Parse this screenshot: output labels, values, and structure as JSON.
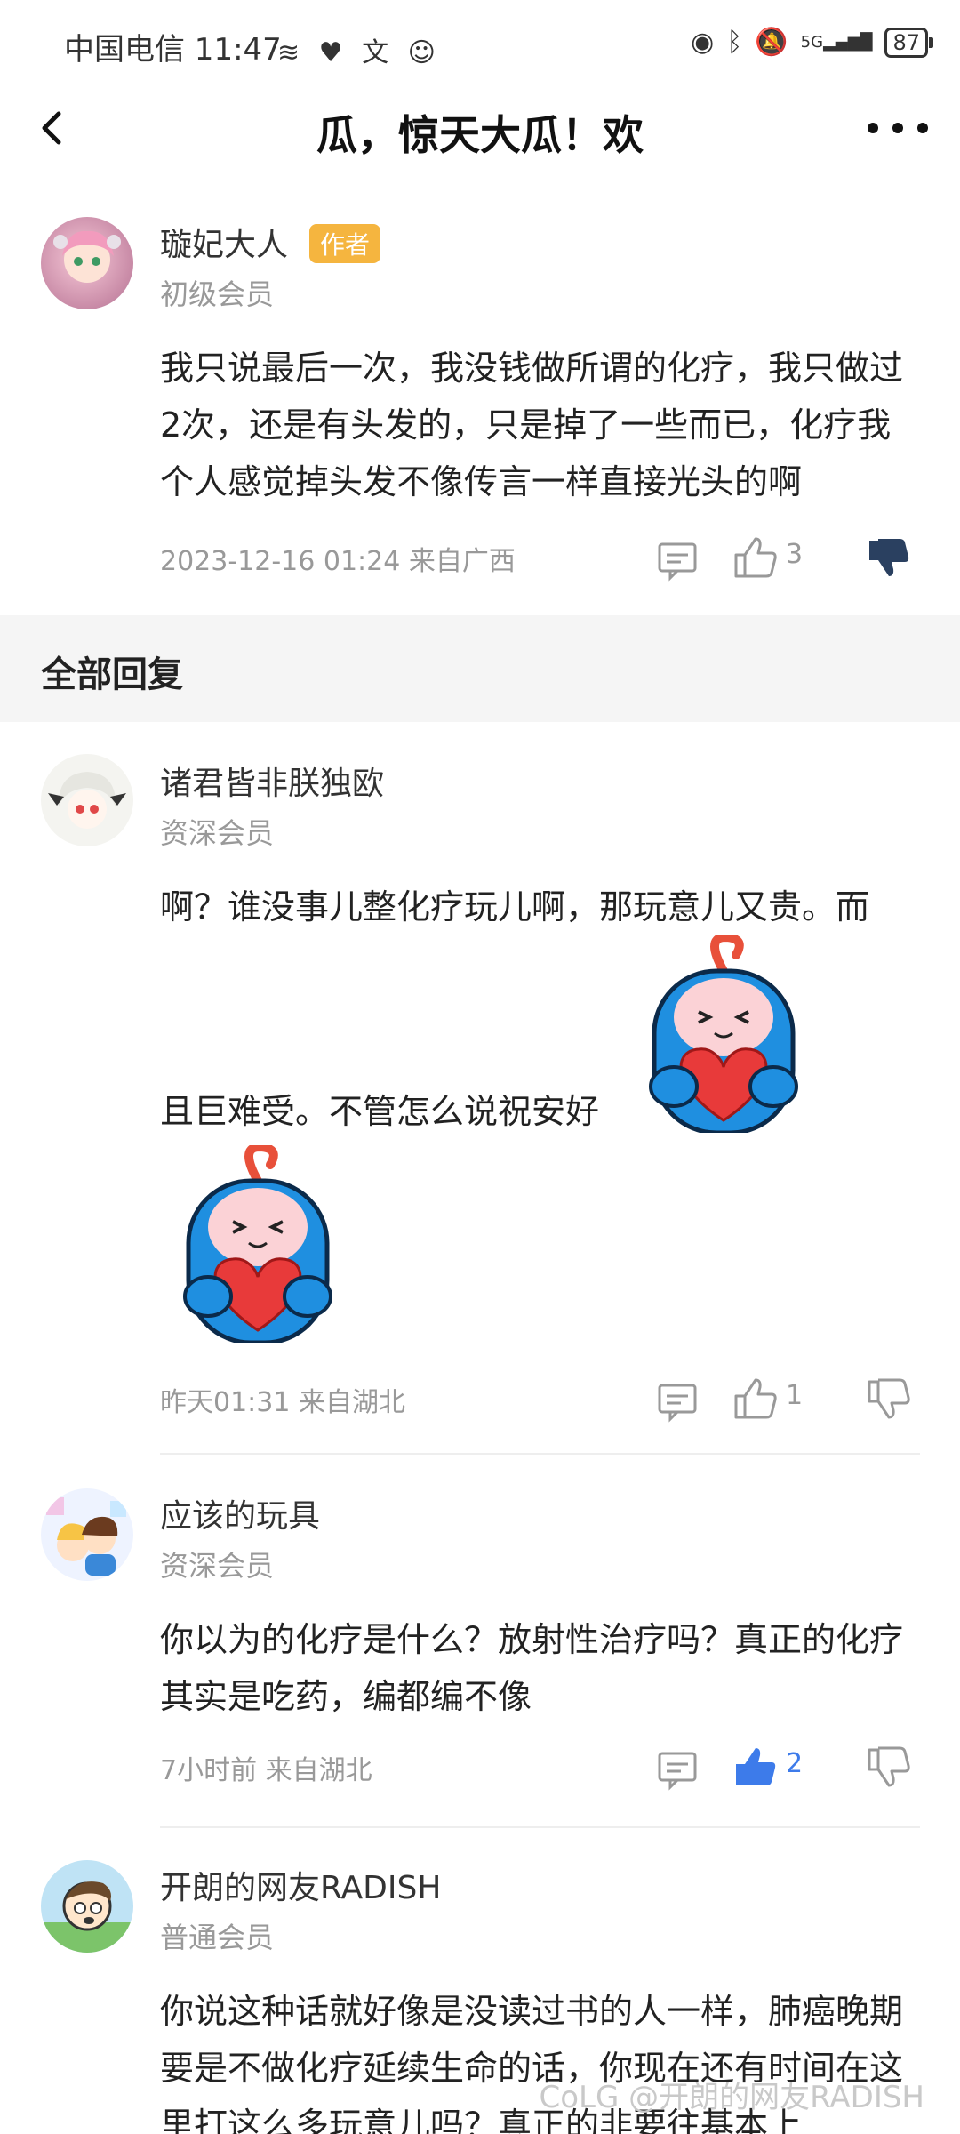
{
  "status_bar": {
    "carrier_time": "中国电信 11:47",
    "battery": "87",
    "signal_label": "5G"
  },
  "header": {
    "title": "瓜，惊天大瓜！欢"
  },
  "op": {
    "username": "璇妃大人",
    "badge": "作者",
    "level": "初级会员",
    "content": "我只说最后一次，我没钱做所谓的化疗，我只做过2次，还是有头发的，只是掉了一些而已，化疗我个人感觉掉头发不像传言一样直接光头的啊",
    "meta": "2023-12-16 01:24  来自广西",
    "likes": "3"
  },
  "section_label": "全部回复",
  "replies": [
    {
      "username": "诸君皆非朕独欧",
      "level": "资深会员",
      "content_line1": "啊？谁没事儿整化疗玩儿啊，那玩意儿又贵。而",
      "content_line2": "且巨难受。不管怎么说祝安好",
      "meta": "昨天01:31  来自湖北",
      "likes": "1"
    },
    {
      "username": "应该的玩具",
      "level": "资深会员",
      "content": "你以为的化疗是什么？放射性治疗吗？真正的化疗其实是吃药，编都编不像",
      "meta": "7小时前  来自湖北",
      "likes": "2"
    },
    {
      "username": "开朗的网友RADISH",
      "level": "普通会员",
      "content": "你说这种话就好像是没读过书的人一样，肺癌晚期要是不做化疗延续生命的话，你现在还有时间在这里打这么多玩意儿吗？真正的非要往基本上"
    }
  ],
  "watermark": "CoLG @开朗的网友RADISH",
  "colors": {
    "accent_blue": "#3d7bea",
    "badge_orange": "#f5b53f",
    "dislike_navy": "#2a4060"
  }
}
